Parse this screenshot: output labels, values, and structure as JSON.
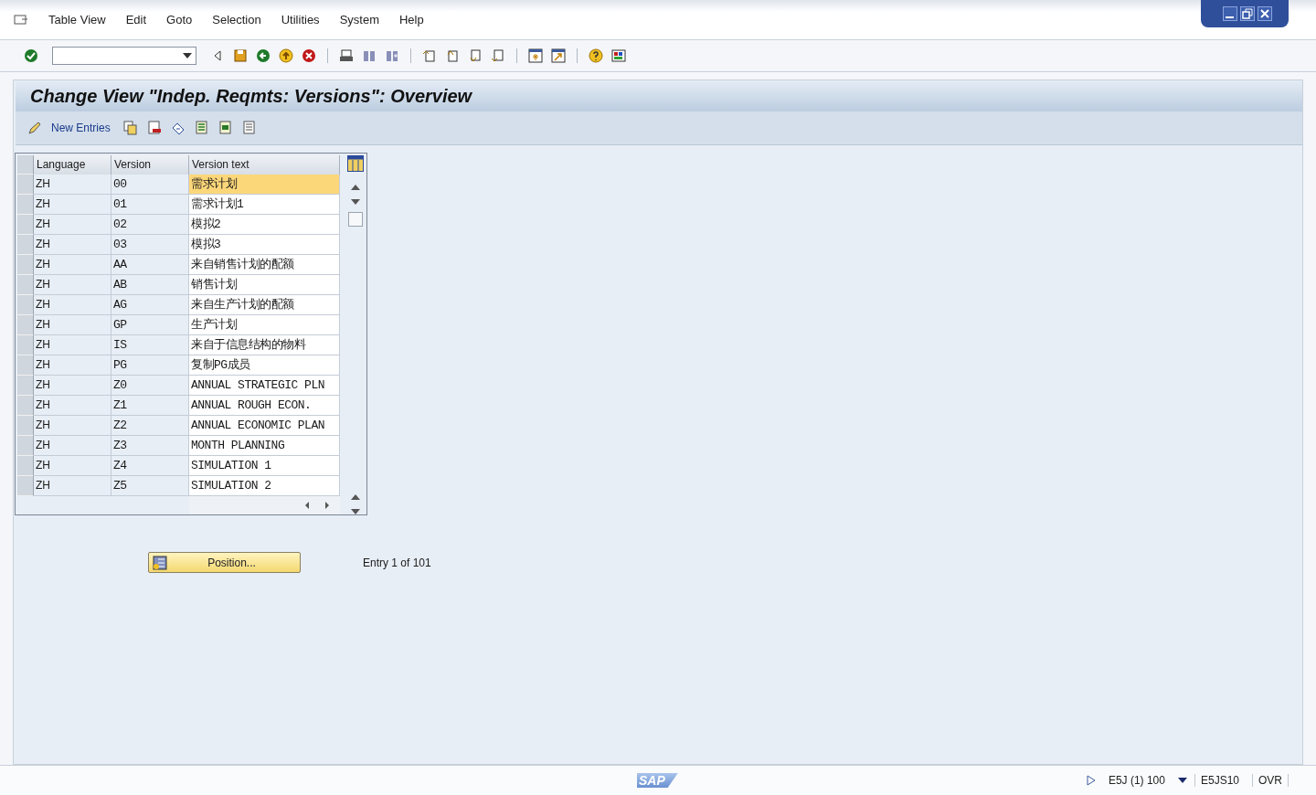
{
  "menu_bar": {
    "items": [
      "Table View",
      "Edit",
      "Goto",
      "Selection",
      "Utilities",
      "System",
      "Help"
    ]
  },
  "screen_title": "Change View \"Indep. Reqmts: Versions\": Overview",
  "app_toolbar": {
    "new_entries": "New Entries"
  },
  "table": {
    "columns": [
      "Language",
      "Version",
      "Version text"
    ],
    "rows": [
      {
        "language": "ZH",
        "version": "00",
        "text": "需求计划",
        "focused": true
      },
      {
        "language": "ZH",
        "version": "01",
        "text": "需求计划1",
        "focused": false
      },
      {
        "language": "ZH",
        "version": "02",
        "text": "模拟2",
        "focused": false
      },
      {
        "language": "ZH",
        "version": "03",
        "text": "模拟3",
        "focused": false
      },
      {
        "language": "ZH",
        "version": "AA",
        "text": "来自销售计划的配额",
        "focused": false
      },
      {
        "language": "ZH",
        "version": "AB",
        "text": "销售计划",
        "focused": false
      },
      {
        "language": "ZH",
        "version": "AG",
        "text": "来自生产计划的配额",
        "focused": false
      },
      {
        "language": "ZH",
        "version": "GP",
        "text": "生产计划",
        "focused": false
      },
      {
        "language": "ZH",
        "version": "IS",
        "text": "来自于信息结构的物料",
        "focused": false
      },
      {
        "language": "ZH",
        "version": "PG",
        "text": "复制PG成员",
        "focused": false
      },
      {
        "language": "ZH",
        "version": "Z0",
        "text": "ANNUAL STRATEGIC PLN",
        "focused": false
      },
      {
        "language": "ZH",
        "version": "Z1",
        "text": "ANNUAL ROUGH ECON.",
        "focused": false
      },
      {
        "language": "ZH",
        "version": "Z2",
        "text": "ANNUAL ECONOMIC PLAN",
        "focused": false
      },
      {
        "language": "ZH",
        "version": "Z3",
        "text": "MONTH PLANNING",
        "focused": false
      },
      {
        "language": "ZH",
        "version": "Z4",
        "text": "SIMULATION 1",
        "focused": false
      },
      {
        "language": "ZH",
        "version": "Z5",
        "text": "SIMULATION 2",
        "focused": false
      }
    ]
  },
  "position_button": "Position...",
  "entry_info": "Entry 1 of 101",
  "status_bar": {
    "logo": "SAP",
    "system": "E5J (1) 100",
    "server": "E5JS10",
    "mode": "OVR"
  }
}
